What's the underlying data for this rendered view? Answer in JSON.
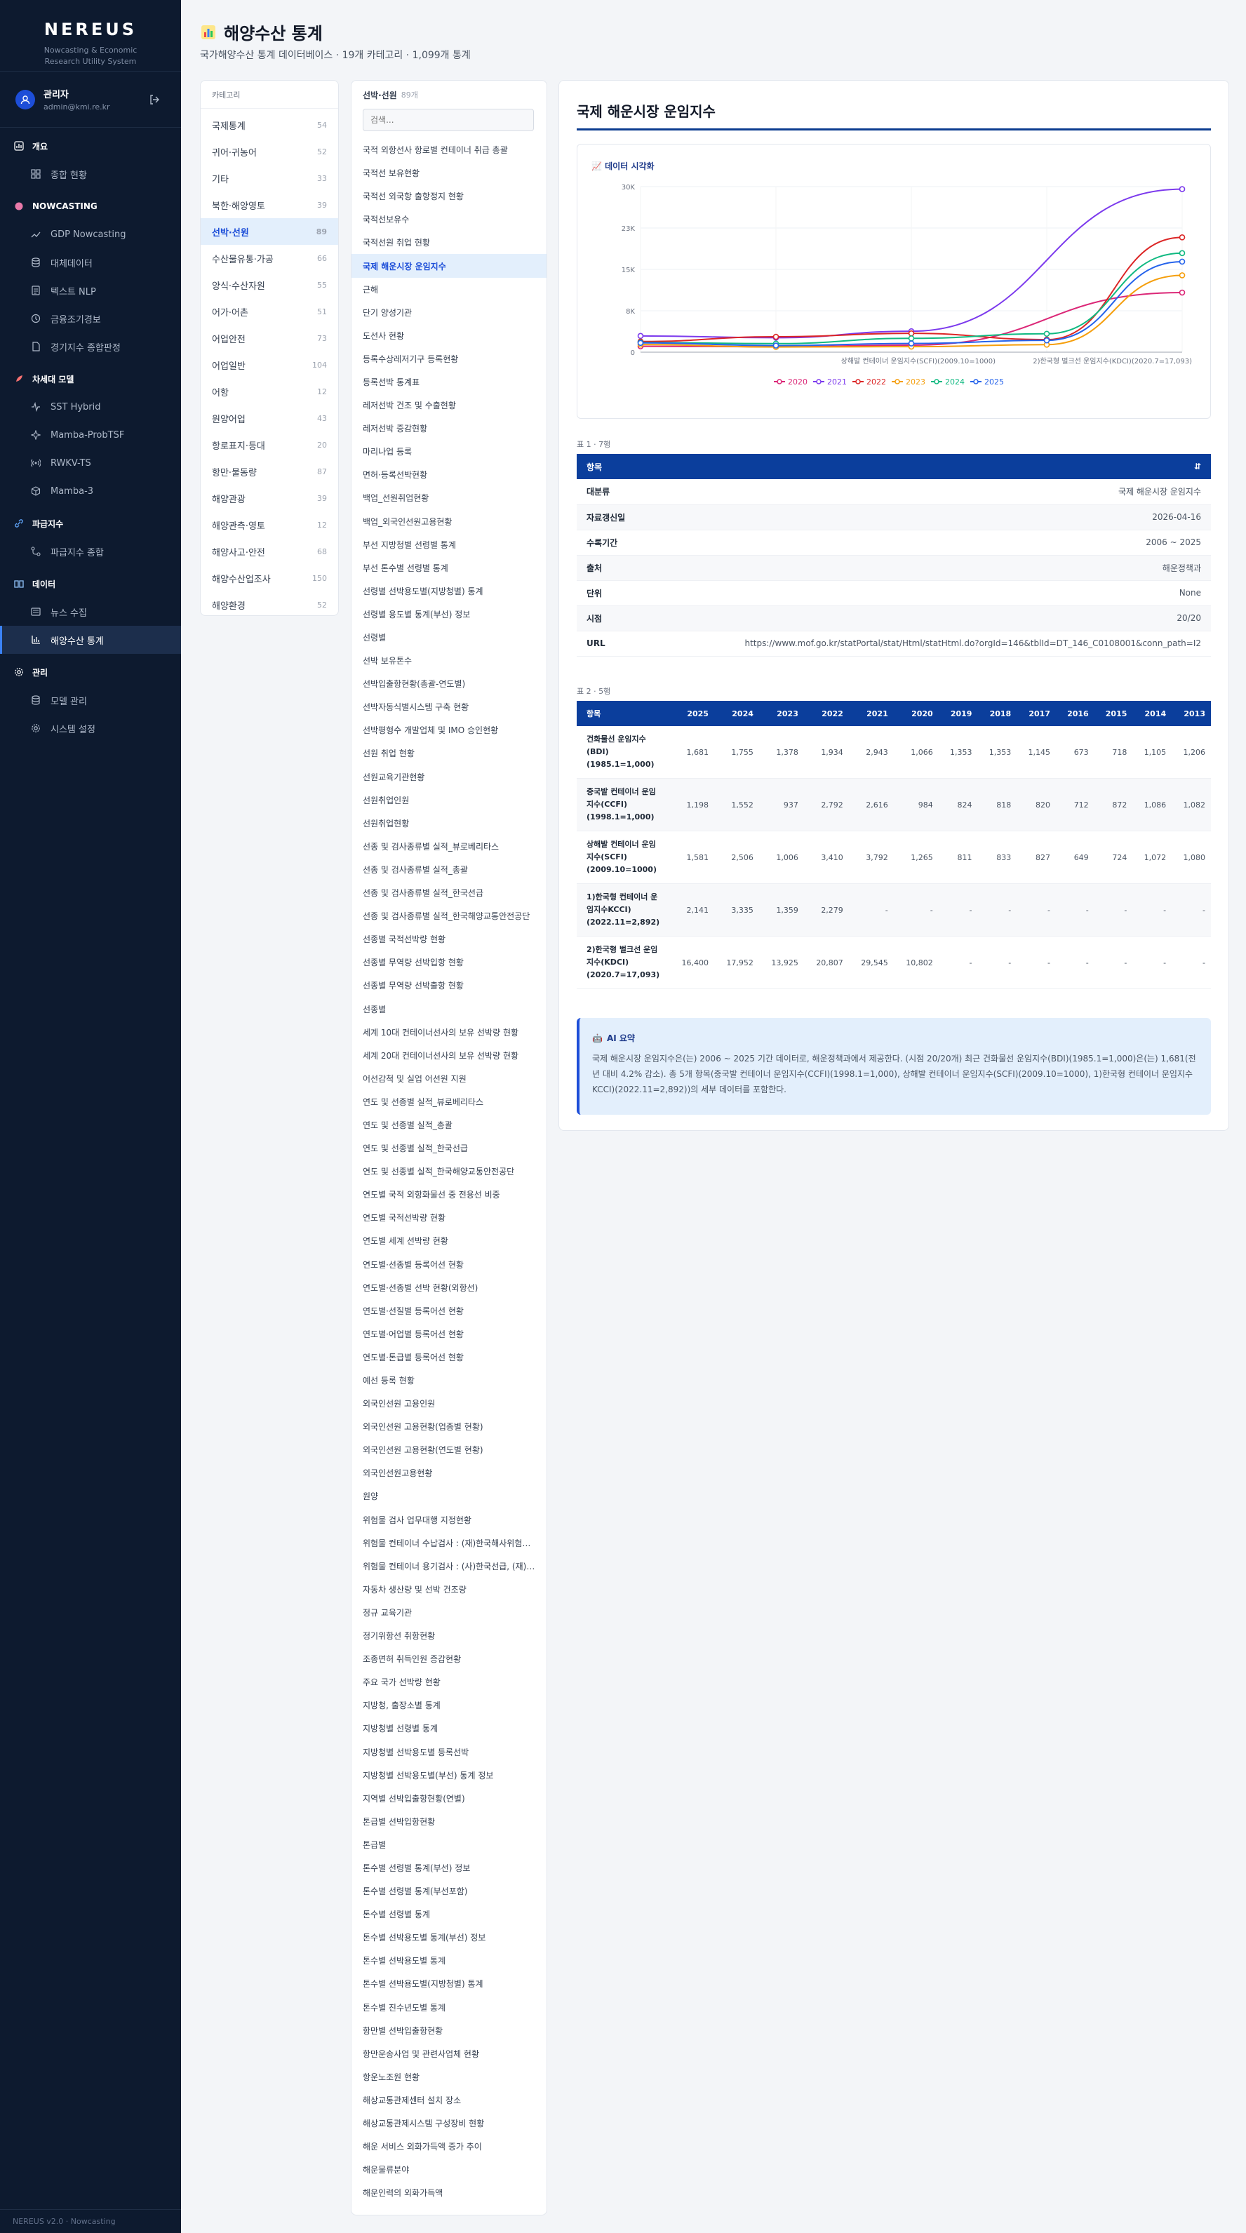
{
  "sidebar": {
    "brand": "NEREUS",
    "brand_sub_1": "Nowcasting & Economic",
    "brand_sub_2": "Research Utility System",
    "user_name": "관리자",
    "user_email": "admin@kmi.re.kr",
    "sections": [
      {
        "title": "개요",
        "icon": "chart-icon",
        "items": [
          {
            "label": "종합 현황",
            "icon": "grid-icon"
          }
        ]
      },
      {
        "title": "NOWCASTING",
        "icon": "brain-icon",
        "items": [
          {
            "label": "GDP Nowcasting",
            "icon": "trend-icon"
          },
          {
            "label": "대체데이터",
            "icon": "database-icon"
          },
          {
            "label": "텍스트 NLP",
            "icon": "document-icon"
          },
          {
            "label": "금융조기경보",
            "icon": "clock-icon"
          },
          {
            "label": "경기지수 종합판정",
            "icon": "file-icon"
          }
        ]
      },
      {
        "title": "차세대 모델",
        "icon": "rocket-icon",
        "items": [
          {
            "label": "SST Hybrid",
            "icon": "pulse-icon"
          },
          {
            "label": "Mamba-ProbTSF",
            "icon": "sparkle-icon"
          },
          {
            "label": "RWKV-TS",
            "icon": "signal-icon"
          },
          {
            "label": "Mamba-3",
            "icon": "cube-icon"
          }
        ]
      },
      {
        "title": "파급지수",
        "icon": "link-icon",
        "items": [
          {
            "label": "파급지수 종합",
            "icon": "network-icon"
          }
        ]
      },
      {
        "title": "데이터",
        "icon": "book-icon",
        "items": [
          {
            "label": "뉴스 수집",
            "icon": "news-icon"
          },
          {
            "label": "해양수산 통계",
            "icon": "bar-chart-icon",
            "active": true
          }
        ]
      },
      {
        "title": "관리",
        "icon": "gear-icon",
        "items": [
          {
            "label": "모델 관리",
            "icon": "database-icon"
          },
          {
            "label": "시스템 설정",
            "icon": "gear-icon"
          }
        ]
      }
    ],
    "footer": "NEREUS v2.0 · Nowcasting"
  },
  "header": {
    "title": "해양수산 통계",
    "subtitle": "국가해양수산 통계 데이터베이스 · 19개 카테고리 · 1,099개 통계"
  },
  "categories": {
    "header": "카테고리",
    "items": [
      {
        "name": "국제통계",
        "count": "54"
      },
      {
        "name": "귀어·귀농어",
        "count": "52"
      },
      {
        "name": "기타",
        "count": "33"
      },
      {
        "name": "북한·해양영토",
        "count": "39"
      },
      {
        "name": "선박·선원",
        "count": "89",
        "active": true
      },
      {
        "name": "수산물유통·가공",
        "count": "66"
      },
      {
        "name": "양식·수산자원",
        "count": "55"
      },
      {
        "name": "어가·어촌",
        "count": "51"
      },
      {
        "name": "어업안전",
        "count": "73"
      },
      {
        "name": "어업일반",
        "count": "104"
      },
      {
        "name": "어항",
        "count": "12"
      },
      {
        "name": "원양어업",
        "count": "43"
      },
      {
        "name": "항로표지·등대",
        "count": "20"
      },
      {
        "name": "항만·물동량",
        "count": "87"
      },
      {
        "name": "해양관광",
        "count": "39"
      },
      {
        "name": "해양관측·영토",
        "count": "12"
      },
      {
        "name": "해양사고·안전",
        "count": "68"
      },
      {
        "name": "해양수산업조사",
        "count": "150"
      },
      {
        "name": "해양환경",
        "count": "52"
      }
    ]
  },
  "datasets": {
    "header": "선박·선원",
    "count": "89개",
    "search_placeholder": "검색...",
    "items": [
      "국적 외항선사 항로별 컨테이너 취급 총괄",
      "국적선 보유현황",
      "국적선 외국항 출항정지 현황",
      "국적선보유수",
      "국적선원 취업 현황",
      "국제 해운시장 운임지수",
      "근해",
      "단기 양성기관",
      "도선사 현황",
      "등록수상레저기구 등록현황",
      "등록선박 통계표",
      "레저선박 건조 및 수출현황",
      "레저선박 증감현황",
      "마리나업 등록",
      "면허·등록선박현황",
      "백업_선원취업현황",
      "백업_외국인선원고용현황",
      "부선 지방청별 선령별 통계",
      "부선 톤수별 선령별 통계",
      "선령별 선박용도별(지방청별) 통계",
      "선령별 용도별 통계(부선) 정보",
      "선령별",
      "선박 보유톤수",
      "선박입출항현황(총괄-연도별)",
      "선박자동식별시스템 구축 현황",
      "선박평형수 개발업체 및 IMO 승인현황",
      "선원 취업 현황",
      "선원교육기관현황",
      "선원취업인원",
      "선원취업현황",
      "선종 및 검사종류별 실적_뷰로베리타스",
      "선종 및 검사종류별 실적_총괄",
      "선종 및 검사종류별 실적_한국선급",
      "선종 및 검사종류별 실적_한국해양교통안전공단",
      "선종별 국적선박량 현황",
      "선종별 무역량 선박입항 현황",
      "선종별 무역량 선박출항 현황",
      "선종별",
      "세계 10대 컨테이너선사의 보유 선박량 현황",
      "세계 20대 컨테이너선사의 보유 선박량 현황",
      "어선감척 및 실업 어선원 지원",
      "연도 및 선종별 실적_뷰로베리타스",
      "연도 및 선종별 실적_총괄",
      "연도 및 선종별 실적_한국선급",
      "연도 및 선종별 실적_한국해양교통안전공단",
      "연도별 국적 외항화물선 중 전용선 비중",
      "연도별 국적선박량 현황",
      "연도별 세계 선박량 현황",
      "연도별·선종별 등록어선 현황",
      "연도별·선종별 선박 현황(외항선)",
      "연도별·선질별 등록어선 현황",
      "연도별·어업별 등록어선 현황",
      "연도별·톤급별 등록어선 현황",
      "예선 등록 현황",
      "외국인선원 고용인원",
      "외국인선원 고용현황(업종별 현황)",
      "외국인선원 고용현황(연도별 현황)",
      "외국인선원고용현황",
      "원양",
      "위험물 검사 업무대행 지정현황",
      "위험물 컨테이너 수납검사 : (재)한국해사위험물검사원",
      "위험물 컨테이너 용기검사 : (사)한국선급, (재)한국해사위험물검사원",
      "자동차 생산량 및 선박 건조량",
      "정규 교육기관",
      "정기위항선 취항현황",
      "조종면허 취득인원 증감현황",
      "주요 국가 선박량 현황",
      "지방청, 출장소별 통계",
      "지방청별 선령별 통계",
      "지방청별 선박용도별 등록선박",
      "지방청별 선박용도별(부선) 통계 정보",
      "지역별 선박입출항현황(연별)",
      "톤급별 선박입항현황",
      "톤급별",
      "톤수별 선령별 통계(부선) 정보",
      "톤수별 선령별 통계(부선포함)",
      "톤수별 선령별 통계",
      "톤수별 선박용도별 통계(부선) 정보",
      "톤수별 선박용도별 통계",
      "톤수별 선박용도별(지방청별) 통계",
      "톤수별 진수년도별 통계",
      "항만별 선박입출항현황",
      "항만운송사업 및 관련사업체 현황",
      "항운노조원 현황",
      "해상교통관제센터 설치 장소",
      "해상교통관제시스템 구성장비 현황",
      "해운 서비스 외화가득액 증가 추이",
      "해운물류분야",
      "해운인력의 외화가득액"
    ],
    "active_index": 5
  },
  "detail": {
    "title": "국제 해운시장 운임지수",
    "chart_label": "데이터 시각화",
    "meta_caption": "표 1 · 7행",
    "meta_header": "항목",
    "meta": [
      {
        "k": "대분류",
        "v": "국제 해운시장 운임지수"
      },
      {
        "k": "자료갱신일",
        "v": "2026-04-16"
      },
      {
        "k": "수록기간",
        "v": "2006 ~ 2025"
      },
      {
        "k": "출처",
        "v": "해운정책과"
      },
      {
        "k": "단위",
        "v": "None"
      },
      {
        "k": "시점",
        "v": "20/20"
      },
      {
        "k": "URL",
        "v": "https://www.mof.go.kr/statPortal/stat/Html/statHtml.do?orgId=146&tblId=DT_146_C0108001&conn_path=I2"
      }
    ],
    "data_caption": "표 2 · 5행",
    "data_header": "항목",
    "years": [
      "2025",
      "2024",
      "2023",
      "2022",
      "2021",
      "2020",
      "2019",
      "2018",
      "2017",
      "2016",
      "2015",
      "2014",
      "2013"
    ],
    "rows": [
      {
        "name": "건화물선 운임지수(BDI) (1985.1=1,000)",
        "values": [
          "1,681",
          "1,755",
          "1,378",
          "1,934",
          "2,943",
          "1,066",
          "1,353",
          "1,353",
          "1,145",
          "673",
          "718",
          "1,105",
          "1,206"
        ]
      },
      {
        "name": "중국발 컨테이너 운임지수(CCFI) (1998.1=1,000)",
        "values": [
          "1,198",
          "1,552",
          "937",
          "2,792",
          "2,616",
          "984",
          "824",
          "818",
          "820",
          "712",
          "872",
          "1,086",
          "1,082"
        ]
      },
      {
        "name": "상해발 컨테이너 운임지수(SCFI) (2009.10=1000)",
        "values": [
          "1,581",
          "2,506",
          "1,006",
          "3,410",
          "3,792",
          "1,265",
          "811",
          "833",
          "827",
          "649",
          "724",
          "1,072",
          "1,080"
        ]
      },
      {
        "name": "1)한국형 컨테이너 운임지수KCCI) (2022.11=2,892)",
        "values": [
          "2,141",
          "3,335",
          "1,359",
          "2,279",
          "-",
          "-",
          "-",
          "-",
          "-",
          "-",
          "-",
          "-",
          "-"
        ]
      },
      {
        "name": "2)한국형 벌크선 운임지수(KDCI) (2020.7=17,093)",
        "values": [
          "16,400",
          "17,952",
          "13,925",
          "20,807",
          "29,545",
          "10,802",
          "-",
          "-",
          "-",
          "-",
          "-",
          "-",
          "-"
        ]
      }
    ],
    "ai_title": "AI 요약",
    "ai_text": "국제 해운시장 운임지수은(는) 2006 ~ 2025 기간 데이터로, 해운정책과에서 제공한다. (시점 20/20개) 최근 건화물선 운임지수(BDI)(1985.1=1,000)은(는) 1,681(전년 대비 4.2% 감소). 총 5개 항목(중국발 컨테이너 운임지수(CCFI)(1998.1=1,000), 상해발 컨테이너 운임지수(SCFI)(2009.10=1000), 1)한국형 컨테이너 운임지수KCCI)(2022.11=2,892))의 세부 데이터를 포함한다."
  },
  "chart_data": {
    "type": "line",
    "title": "",
    "x": [
      "건화물선 운임지수(BDI)(1985.1=1,000)",
      "중국발 컨테이너 운임지수(CCFI)(1998.1=1,000)",
      "상해발 컨테이너 운임지수(SCFI)(2009.10=1000)",
      "1)한국형 컨테이너 운임지수KCCI)(2022.11=2,892)",
      "2)한국형 벌크선 운임지수(KDCI)(2020.7=17,093)"
    ],
    "x_tick_labels": [
      "상해발 컨테이너 운임지수(SCFI)(2009.10=1000)",
      "2)한국형 벌크선 운임지수(KDCI)(2020.7=17,093)"
    ],
    "ylim": [
      0,
      30000
    ],
    "y_ticks": [
      "0",
      "8K",
      "15K",
      "23K",
      "30K"
    ],
    "grid": true,
    "legend": "bottom",
    "series": [
      {
        "name": "2020",
        "color": "#db2777",
        "values": [
          1066,
          984,
          1265,
          null,
          10802
        ]
      },
      {
        "name": "2021",
        "color": "#7c3aed",
        "values": [
          2943,
          2616,
          3792,
          null,
          29545
        ]
      },
      {
        "name": "2022",
        "color": "#dc2626",
        "values": [
          1934,
          2792,
          3410,
          2279,
          20807
        ]
      },
      {
        "name": "2023",
        "color": "#f59e0b",
        "values": [
          1378,
          937,
          1006,
          1359,
          13925
        ]
      },
      {
        "name": "2024",
        "color": "#10b981",
        "values": [
          1755,
          1552,
          2506,
          3335,
          17952
        ]
      },
      {
        "name": "2025",
        "color": "#2563eb",
        "values": [
          1681,
          1198,
          1581,
          2141,
          16400
        ]
      }
    ]
  }
}
